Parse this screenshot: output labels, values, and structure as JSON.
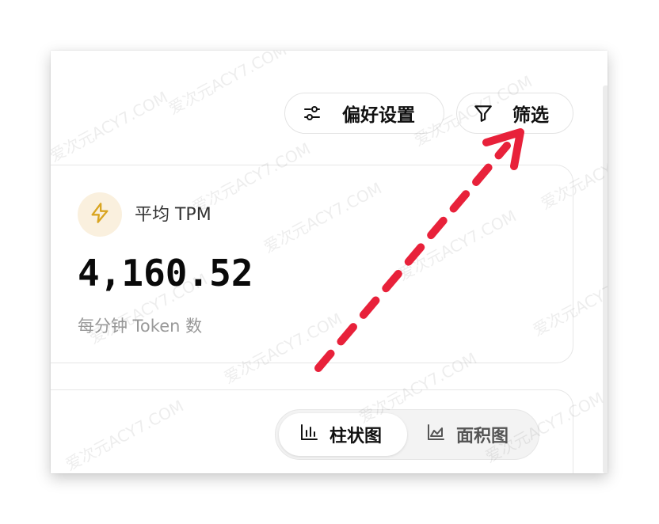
{
  "toolbar": {
    "preferences_label": "偏好设置",
    "filter_label": "筛选"
  },
  "stat_card": {
    "title": "平均 TPM",
    "value": "4,160.52",
    "subtitle": "每分钟 Token 数",
    "icon": "lightning-icon",
    "icon_color": "#d9a521",
    "icon_bg": "#faf0de"
  },
  "chart_toggle": {
    "options": [
      {
        "label": "柱状图",
        "icon": "bar-chart-icon",
        "selected": true
      },
      {
        "label": "面积图",
        "icon": "area-chart-icon",
        "selected": false
      }
    ]
  },
  "annotation": {
    "arrow_color": "#e8213a"
  },
  "watermark_text": "爱次元ACY7.COM"
}
